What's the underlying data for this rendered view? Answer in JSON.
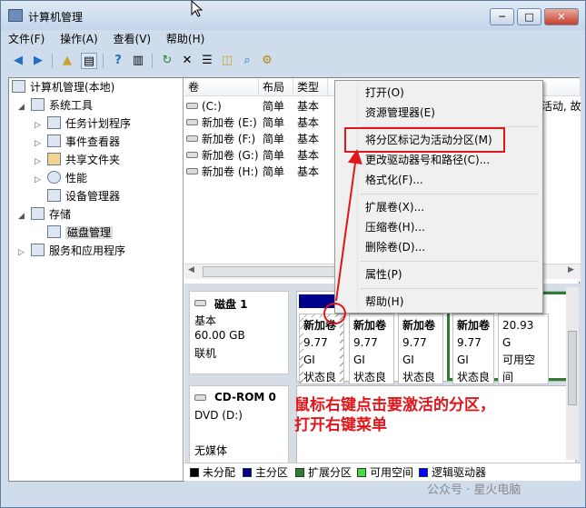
{
  "window": {
    "title": "计算机管理",
    "buttons": {
      "minimize": "─",
      "maximize": "□",
      "close": "✕"
    }
  },
  "menubar": [
    "文件(F)",
    "操作(A)",
    "查看(V)",
    "帮助(H)"
  ],
  "tree": {
    "root": "计算机管理(本地)",
    "system_tools": "系统工具",
    "task_scheduler": "任务计划程序",
    "event_viewer": "事件查看器",
    "shared_folders": "共享文件夹",
    "performance": "性能",
    "device_manager": "设备管理器",
    "storage": "存储",
    "disk_management": "磁盘管理",
    "services_apps": "服务和应用程序"
  },
  "volumes": {
    "headers": [
      "卷",
      "布局",
      "类型"
    ],
    "rows": [
      {
        "name": "(C:)",
        "layout": "简单",
        "type": "基本"
      },
      {
        "name": "新加卷 (E:)",
        "layout": "简单",
        "type": "基本"
      },
      {
        "name": "新加卷 (F:)",
        "layout": "简单",
        "type": "基本"
      },
      {
        "name": "新加卷 (G:)",
        "layout": "简单",
        "type": "基本"
      },
      {
        "name": "新加卷 (H:)",
        "layout": "简单",
        "type": "基本"
      }
    ],
    "overflow_text": "活动, 故"
  },
  "disk1": {
    "name": "磁盘 1",
    "type": "基本",
    "size": "60.00 GB",
    "status": "联机",
    "partitions": [
      {
        "name": "新加卷",
        "size": "9.77 GI",
        "status": "状态良好"
      },
      {
        "name": "新加卷",
        "size": "9.77 GI",
        "status": "状态良好"
      },
      {
        "name": "新加卷",
        "size": "9.77 GI",
        "status": "状态良好"
      },
      {
        "name": "新加卷",
        "size": "9.77 GI",
        "status": "状态良好"
      }
    ],
    "free": {
      "size": "20.93 G",
      "status": "可用空间"
    }
  },
  "cdrom": {
    "name": "CD-ROM 0",
    "drive": "DVD (D:)",
    "media": "无媒体"
  },
  "legend": [
    {
      "label": "未分配",
      "color": "#000000"
    },
    {
      "label": "主分区",
      "color": "#00008b"
    },
    {
      "label": "扩展分区",
      "color": "#2e7d32"
    },
    {
      "label": "可用空间",
      "color": "#44dd44"
    },
    {
      "label": "逻辑驱动器",
      "color": "#0000ff"
    }
  ],
  "context_menu": {
    "open": "打开(O)",
    "explore": "资源管理器(E)",
    "mark_active": "将分区标记为活动分区(M)",
    "change_letter": "更改驱动器号和路径(C)...",
    "format": "格式化(F)...",
    "extend": "扩展卷(X)...",
    "shrink": "压缩卷(H)...",
    "delete": "删除卷(D)...",
    "properties": "属性(P)",
    "help": "帮助(H)"
  },
  "annotation": {
    "line1": "鼠标右键点击要激活的分区，",
    "line2": "打开右键菜单"
  },
  "watermark": "公众号 · 星火电脑",
  "colors": {
    "highlight": "#e0161a",
    "primary_partition": "#00008b"
  }
}
